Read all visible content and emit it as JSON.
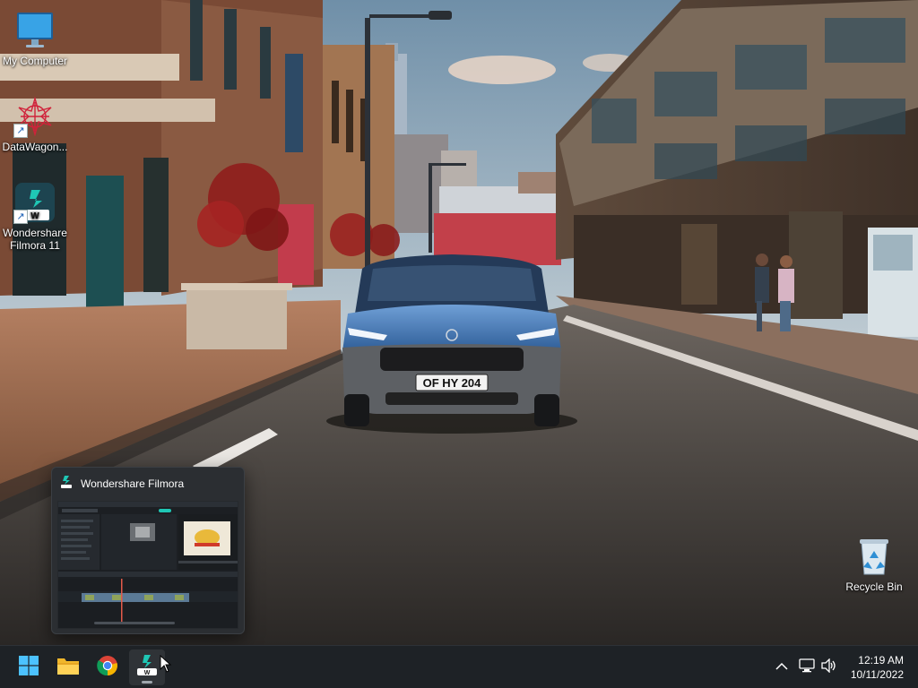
{
  "desktop": {
    "icons": [
      {
        "label": "My Computer",
        "icon": "monitor-icon"
      },
      {
        "label": "DataWagon...",
        "icon": "datawagon-logo-icon"
      },
      {
        "label": "Wondershare Filmora 11",
        "icon": "filmora-icon"
      },
      {
        "label": "Recycle Bin",
        "icon": "recycle-bin-icon"
      }
    ]
  },
  "wallpaper": {
    "plate": "OF HY 204"
  },
  "preview": {
    "title": "Wondershare Filmora",
    "icon": "filmora-icon"
  },
  "taskbar": {
    "apps": [
      {
        "name": "Start",
        "icon": "windows-start-icon"
      },
      {
        "name": "File Explorer",
        "icon": "folder-icon"
      },
      {
        "name": "Google Chrome",
        "icon": "chrome-icon"
      },
      {
        "name": "Wondershare Filmora",
        "icon": "filmora-icon",
        "active": true
      }
    ],
    "tray": {
      "icons": [
        "chevron-up-icon",
        "network-icon",
        "volume-icon"
      ]
    },
    "clock": {
      "time": "12:19 AM",
      "date": "10/11/2022"
    }
  },
  "colors": {
    "taskbar": "#1e2226",
    "filmora": "#1fc7b5",
    "chrome_red": "#db4437",
    "chrome_yellow": "#f4b400",
    "chrome_green": "#0f9d58",
    "chrome_blue": "#4285f4"
  }
}
